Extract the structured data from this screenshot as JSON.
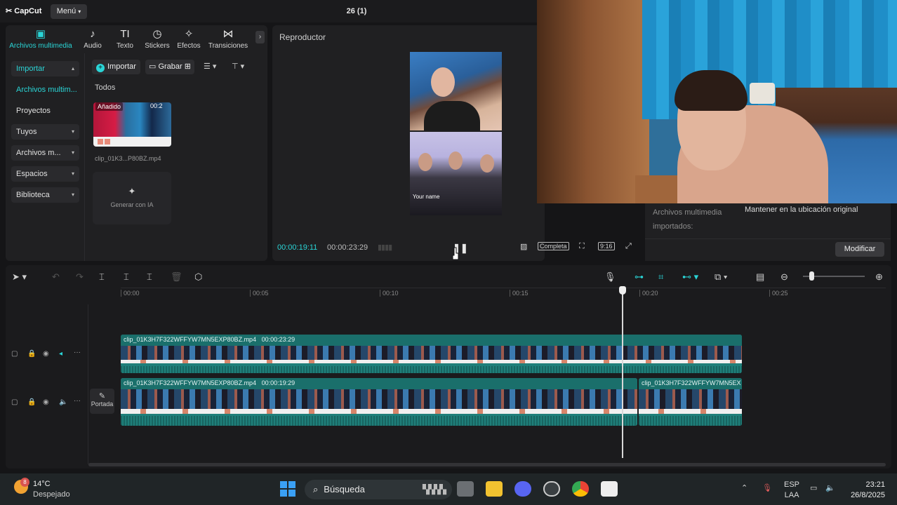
{
  "app": {
    "logo": "CapCut",
    "menu_label": "Menú",
    "title": "26 (1)"
  },
  "toptabs": [
    {
      "label": "Archivos multimedia",
      "icon": "▣",
      "active": true
    },
    {
      "label": "Audio",
      "icon": "♪"
    },
    {
      "label": "Texto",
      "icon": "TI"
    },
    {
      "label": "Stickers",
      "icon": "◷"
    },
    {
      "label": "Efectos",
      "icon": "✧"
    },
    {
      "label": "Transiciones",
      "icon": "⋈"
    }
  ],
  "sidebar": [
    {
      "label": "Importar",
      "chevron": "▴",
      "box": true,
      "active": true
    },
    {
      "label": "Archivos multim...",
      "active": true
    },
    {
      "label": "Proyectos secun..."
    },
    {
      "label": "Tuyos",
      "chevron": "▾",
      "box": true
    },
    {
      "label": "Archivos m...",
      "chevron": "▾",
      "box": true
    },
    {
      "label": "Espacios",
      "chevron": "▾",
      "box": true
    },
    {
      "label": "Biblioteca",
      "chevron": "▾",
      "box": true
    }
  ],
  "media_toolbar": {
    "import_label": "Importar",
    "record_label": "Grabar"
  },
  "media": {
    "section_label": "Todos",
    "item": {
      "badge": "Añadido",
      "duration": "00:2",
      "name": "clip_01K3...P80BZ.mp4"
    },
    "gen_ai_label": "Generar con IA"
  },
  "player": {
    "title": "Reproductor",
    "preview_name": "Your name",
    "time_current": "00:00:19:11",
    "time_total": "00:00:23:29",
    "complete_label": "Completa",
    "ratio_label": "9:16"
  },
  "import_info": {
    "label": "Archivos multimedia importados:",
    "value": "Mantener en la ubicación original",
    "modify_label": "Modificar"
  },
  "timeline": {
    "ticks": [
      "00:00",
      "00:05",
      "00:10",
      "00:15",
      "00:20",
      "00:25"
    ],
    "cover_label": "Portada",
    "clips": [
      {
        "name": "clip_01K3H7F322WFFYW7MN5EXP80BZ.mp4",
        "duration": "00:00:23:29"
      },
      {
        "name": "clip_01K3H7F322WFFYW7MN5EXP80BZ.mp4",
        "duration": "00:00:19:29"
      },
      {
        "name": "clip_01K3H7F322WFFYW7MN5EX"
      }
    ]
  },
  "taskbar": {
    "weather_badge": "8",
    "temperature": "14°C",
    "weather_desc": "Despejado",
    "search_label": "Búsqueda",
    "lang_top": "ESP",
    "lang_bottom": "LAA",
    "time": "23:21",
    "date": "26/8/2025"
  },
  "colors": {
    "accent": "#2ad5d7",
    "clip": "#1f7f7a",
    "background": "#151517"
  }
}
